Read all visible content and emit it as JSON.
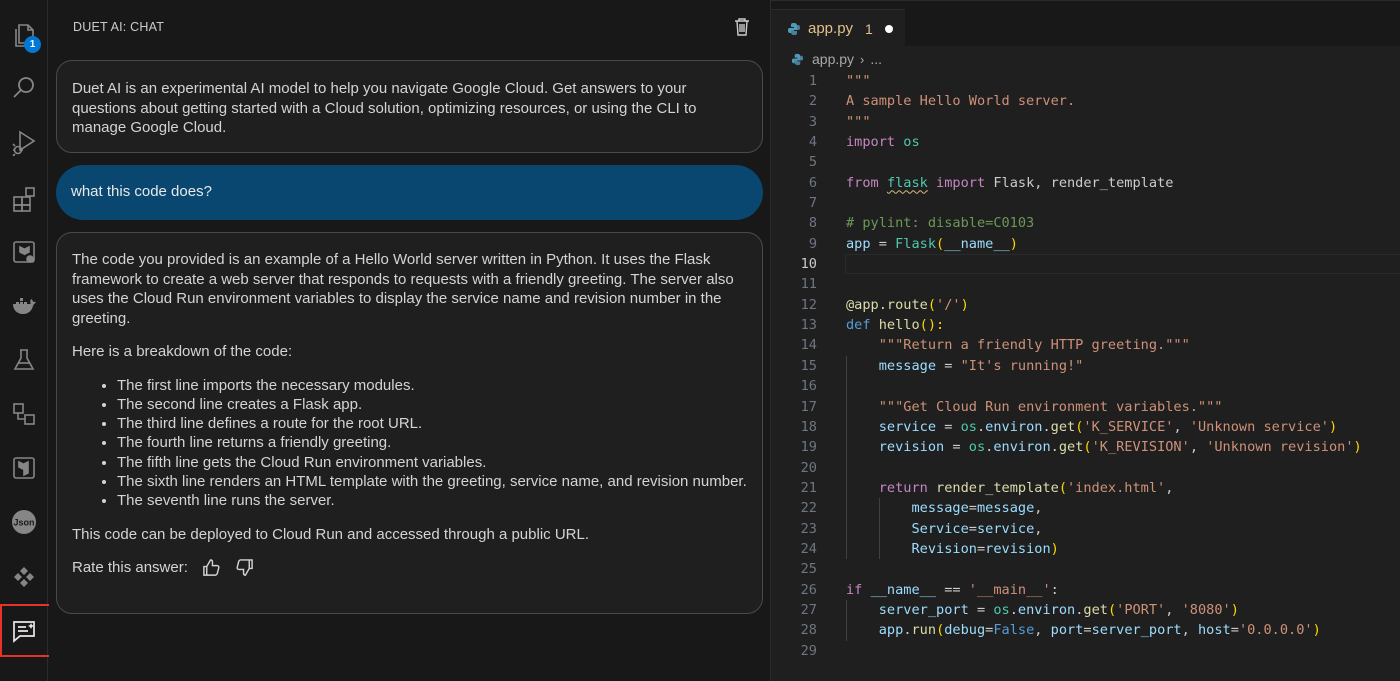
{
  "activity_bar": {
    "explorer_badge": "1",
    "items": [
      "files-icon",
      "search-icon",
      "run-debug-icon",
      "extensions-icon",
      "terraform-cloud-icon",
      "docker-icon",
      "testing-icon",
      "remote-explorer-icon",
      "terraform-icon",
      "json-icon",
      "diamonds-icon",
      "duet-ai-chat-icon"
    ],
    "active_item": "duet-ai-chat-icon",
    "active_outline_color": "#e5322a"
  },
  "chat": {
    "title": "DUET AI: CHAT",
    "intro": "Duet AI is an experimental AI model to help you navigate Google Cloud. Get answers to your questions about getting started with a Cloud solution, optimizing resources, or using the CLI to manage Google Cloud.",
    "user_prompt": "what this code does?",
    "answer": {
      "paragraph_1": "The code you provided is an example of a Hello World server written in Python. It uses the Flask framework to create a web server that responds to requests with a friendly greeting. The server also uses the Cloud Run environment variables to display the service name and revision number in the greeting.",
      "paragraph_2": "Here is a breakdown of the code:",
      "bullets": [
        "The first line imports the necessary modules.",
        "The second line creates a Flask app.",
        "The third line defines a route for the root URL.",
        "The fourth line returns a friendly greeting.",
        "The fifth line gets the Cloud Run environment variables.",
        "The sixth line renders an HTML template with the greeting, service name, and revision number.",
        "The seventh line runs the server."
      ],
      "paragraph_3": "This code can be deployed to Cloud Run and accessed through a public URL.",
      "rate_label": "Rate this answer:"
    },
    "user_bubble_color": "#094771"
  },
  "editor": {
    "tab": {
      "filename": "app.py",
      "problems": "1",
      "modified": true
    },
    "breadcrumb": {
      "file": "app.py",
      "separator": "›",
      "rest": "..."
    },
    "current_line": "10",
    "line_numbers": [
      "1",
      "2",
      "3",
      "4",
      "5",
      "6",
      "7",
      "8",
      "9",
      "10",
      "11",
      "12",
      "13",
      "14",
      "15",
      "16",
      "17",
      "18",
      "19",
      "20",
      "21",
      "22",
      "23",
      "24",
      "25",
      "26",
      "27",
      "28",
      "29"
    ],
    "code": {
      "l1": "\"\"\"",
      "l2": "A sample Hello World server.",
      "l3": "\"\"\"",
      "l4_kw": "import",
      "l4_mod": "os",
      "l6_from": "from",
      "l6_mod": "flask",
      "l6_import": "import",
      "l6_names": "Flask, render_template",
      "l8": "# pylint: disable=C0103",
      "l9_var": "app",
      "l9_eq": " = ",
      "l9_cls": "Flask",
      "l9_open": "(",
      "l9_arg": "__name__",
      "l9_close": ")",
      "l12_dec": "@app.route",
      "l12_open": "(",
      "l12_str": "'/'",
      "l12_close": ")",
      "l13_def": "def",
      "l13_fn": "hello",
      "l13_parens": "():",
      "l14": "\"\"\"Return a friendly HTTP greeting.\"\"\"",
      "l15_var": "message",
      "l15_eq": " = ",
      "l15_str": "\"It's running!\"",
      "l17": "\"\"\"Get Cloud Run environment variables.\"\"\"",
      "l18_var": "service",
      "l18_eq": " = ",
      "l18_obj": "os",
      "l18_dot": ".",
      "l18_env": "environ",
      "l18_dot2": ".",
      "l18_fn": "get",
      "l18_open": "(",
      "l18_a1": "'K_SERVICE'",
      "l18_sep": ", ",
      "l18_a2": "'Unknown service'",
      "l18_close": ")",
      "l19_var": "revision",
      "l19_eq": " = ",
      "l19_obj": "os",
      "l19_dot": ".",
      "l19_env": "environ",
      "l19_dot2": ".",
      "l19_fn": "get",
      "l19_open": "(",
      "l19_a1": "'K_REVISION'",
      "l19_sep": ", ",
      "l19_a2": "'Unknown revision'",
      "l19_close": ")",
      "l21_kw": "return",
      "l21_fn": "render_template",
      "l21_open": "(",
      "l21_str": "'index.html'",
      "l21_comma": ",",
      "l22_k": "message",
      "l22_eq": "=",
      "l22_v": "message",
      "l22_comma": ",",
      "l23_k": "Service",
      "l23_eq": "=",
      "l23_v": "service",
      "l23_comma": ",",
      "l24_k": "Revision",
      "l24_eq": "=",
      "l24_v": "revision",
      "l24_close": ")",
      "l26_kw": "if",
      "l26_name": "__name__",
      "l26_eq": " == ",
      "l26_str": "'__main__'",
      "l26_colon": ":",
      "l27_var": "server_port",
      "l27_eq": " = ",
      "l27_obj": "os",
      "l27_dot": ".",
      "l27_env": "environ",
      "l27_dot2": ".",
      "l27_fn": "get",
      "l27_open": "(",
      "l27_a1": "'PORT'",
      "l27_sep": ", ",
      "l27_a2": "'8080'",
      "l27_close": ")",
      "l28_obj": "app",
      "l28_dot": ".",
      "l28_fn": "run",
      "l28_open": "(",
      "l28_k1": "debug",
      "l28_eq1": "=",
      "l28_v1": "False",
      "l28_sep1": ", ",
      "l28_k2": "port",
      "l28_eq2": "=",
      "l28_v2": "server_port",
      "l28_sep2": ", ",
      "l28_k3": "host",
      "l28_eq3": "=",
      "l28_v3": "'0.0.0.0'",
      "l28_close": ")"
    }
  }
}
